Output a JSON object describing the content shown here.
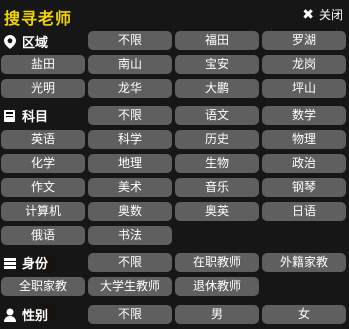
{
  "header": {
    "title": "搜寻老师",
    "close_label": "关闭"
  },
  "sections": {
    "region": {
      "label": "区域",
      "options": [
        "不限",
        "福田",
        "罗湖",
        "盐田",
        "南山",
        "宝安",
        "龙岗",
        "光明",
        "龙华",
        "大鹏",
        "坪山"
      ]
    },
    "subject": {
      "label": "科目",
      "options": [
        "不限",
        "语文",
        "数学",
        "英语",
        "科学",
        "历史",
        "物理",
        "化学",
        "地理",
        "生物",
        "政治",
        "作文",
        "美术",
        "音乐",
        "钢琴",
        "计算机",
        "奥数",
        "奥英",
        "日语",
        "俄语",
        "书法"
      ]
    },
    "identity": {
      "label": "身份",
      "options": [
        "不限",
        "在职教师",
        "外籍家教",
        "全职家教",
        "大学生教师",
        "退休教师"
      ]
    },
    "gender": {
      "label": "性别",
      "options": [
        "不限",
        "男",
        "女"
      ]
    }
  },
  "colors": {
    "title": "#f0d400",
    "button": "#5f5f5f",
    "overlay": "rgba(0,0,0,0.86)"
  }
}
